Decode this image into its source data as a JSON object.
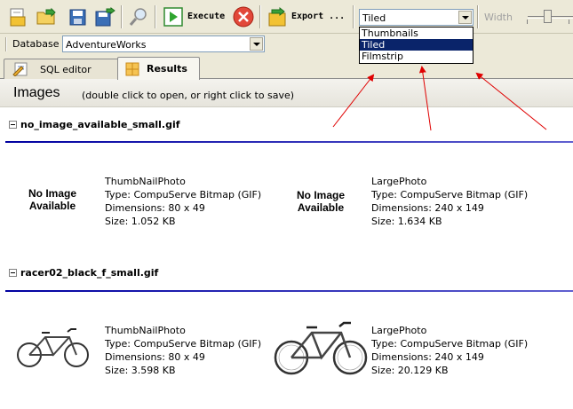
{
  "toolbar": {
    "execute_label": "Execute",
    "export_label": "Export ...",
    "view_mode_value": "Tiled",
    "width_label": "Width"
  },
  "view_dropdown": {
    "options": [
      "Thumbnails",
      "Tiled",
      "Filmstrip"
    ],
    "selected": "Tiled"
  },
  "database": {
    "label": "Database",
    "value": "AdventureWorks"
  },
  "tabs": [
    {
      "label": "SQL editor",
      "active": false
    },
    {
      "label": "Results",
      "active": true
    }
  ],
  "images_panel": {
    "title": "Images",
    "hint": "(double click to open, or right click to save)"
  },
  "sections": [
    {
      "name": "no_image_available_small.gif",
      "placeholder_line1": "No Image",
      "placeholder_line2": "Available",
      "items": [
        {
          "title": "ThumbNailPhoto",
          "type": "Type: CompuServe Bitmap (GIF)",
          "dimensions": "Dimensions: 80 x 49",
          "size": "Size: 1.052 KB"
        },
        {
          "title": "LargePhoto",
          "type": "Type: CompuServe Bitmap (GIF)",
          "dimensions": "Dimensions: 240 x 149",
          "size": "Size: 1.634 KB"
        }
      ]
    },
    {
      "name": "racer02_black_f_small.gif",
      "items": [
        {
          "title": "ThumbNailPhoto",
          "type": "Type: CompuServe Bitmap (GIF)",
          "dimensions": "Dimensions: 80 x 49",
          "size": "Size: 3.598 KB"
        },
        {
          "title": "LargePhoto",
          "type": "Type: CompuServe Bitmap (GIF)",
          "dimensions": "Dimensions: 240 x 149",
          "size": "Size: 20.129 KB"
        }
      ]
    }
  ],
  "colors": {
    "accent_blue": "#0a246a",
    "annotation_red": "#e00000",
    "section_line": "#0000a0"
  }
}
